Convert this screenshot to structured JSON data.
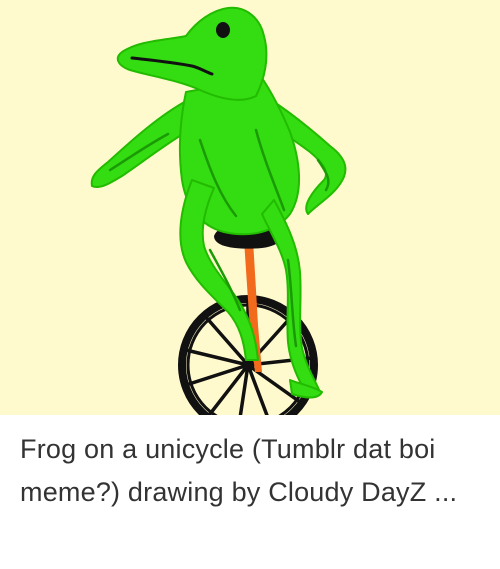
{
  "drawing": {
    "subject": "frog-on-unicycle",
    "colors": {
      "background": "#fffacd",
      "frog_fill": "#33dd11",
      "frog_stroke": "#22bb00",
      "frog_dark": "#1a9a05",
      "eye": "#111111",
      "seat": "#111111",
      "fork": "#f26b1d",
      "wheel": "#111111"
    }
  },
  "caption": {
    "text": "Frog on a unicycle (Tumblr dat boi meme?) drawing by Cloudy DayZ ..."
  }
}
